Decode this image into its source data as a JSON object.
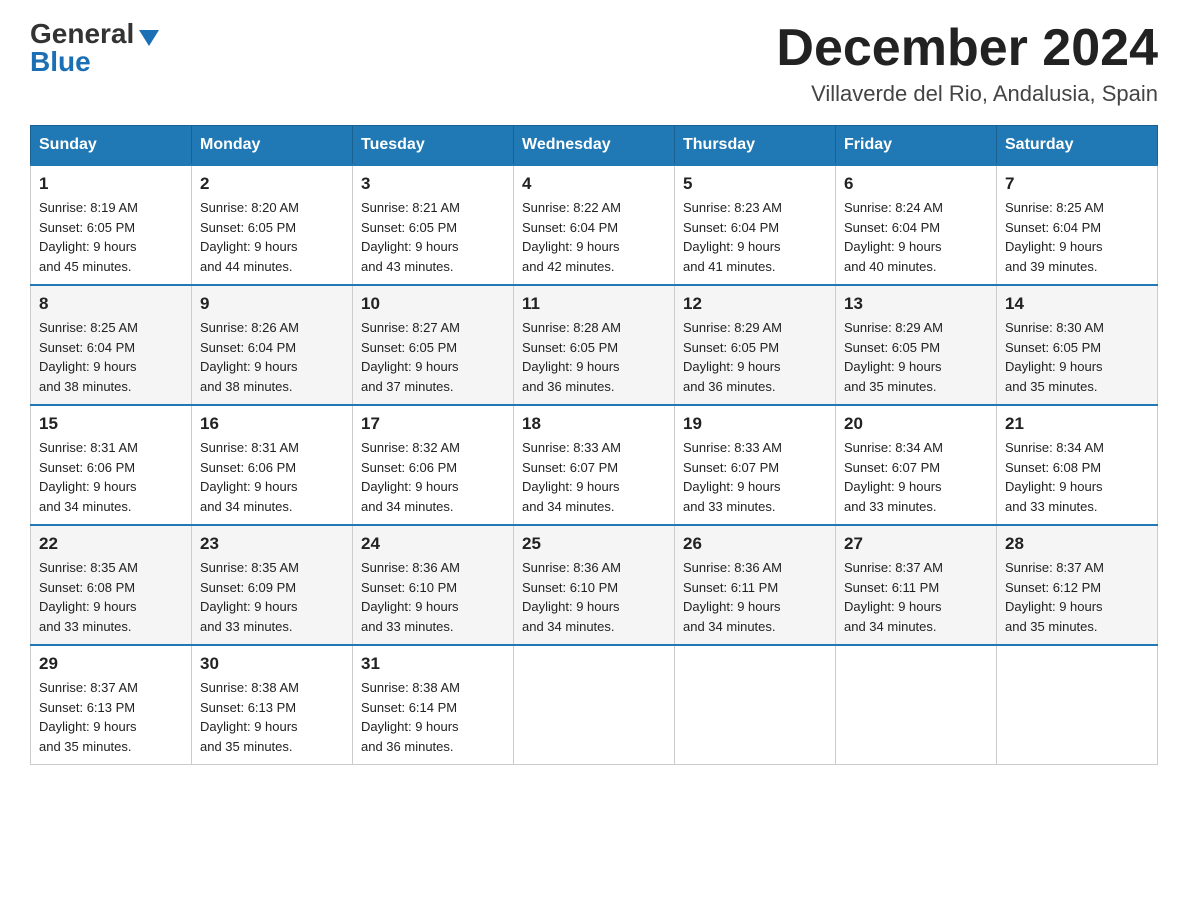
{
  "header": {
    "logo_general": "General",
    "logo_blue": "Blue",
    "month_title": "December 2024",
    "location": "Villaverde del Rio, Andalusia, Spain"
  },
  "days_of_week": [
    "Sunday",
    "Monday",
    "Tuesday",
    "Wednesday",
    "Thursday",
    "Friday",
    "Saturday"
  ],
  "weeks": [
    [
      {
        "day": "1",
        "sunrise": "Sunrise: 8:19 AM",
        "sunset": "Sunset: 6:05 PM",
        "daylight": "Daylight: 9 hours",
        "daylight2": "and 45 minutes."
      },
      {
        "day": "2",
        "sunrise": "Sunrise: 8:20 AM",
        "sunset": "Sunset: 6:05 PM",
        "daylight": "Daylight: 9 hours",
        "daylight2": "and 44 minutes."
      },
      {
        "day": "3",
        "sunrise": "Sunrise: 8:21 AM",
        "sunset": "Sunset: 6:05 PM",
        "daylight": "Daylight: 9 hours",
        "daylight2": "and 43 minutes."
      },
      {
        "day": "4",
        "sunrise": "Sunrise: 8:22 AM",
        "sunset": "Sunset: 6:04 PM",
        "daylight": "Daylight: 9 hours",
        "daylight2": "and 42 minutes."
      },
      {
        "day": "5",
        "sunrise": "Sunrise: 8:23 AM",
        "sunset": "Sunset: 6:04 PM",
        "daylight": "Daylight: 9 hours",
        "daylight2": "and 41 minutes."
      },
      {
        "day": "6",
        "sunrise": "Sunrise: 8:24 AM",
        "sunset": "Sunset: 6:04 PM",
        "daylight": "Daylight: 9 hours",
        "daylight2": "and 40 minutes."
      },
      {
        "day": "7",
        "sunrise": "Sunrise: 8:25 AM",
        "sunset": "Sunset: 6:04 PM",
        "daylight": "Daylight: 9 hours",
        "daylight2": "and 39 minutes."
      }
    ],
    [
      {
        "day": "8",
        "sunrise": "Sunrise: 8:25 AM",
        "sunset": "Sunset: 6:04 PM",
        "daylight": "Daylight: 9 hours",
        "daylight2": "and 38 minutes."
      },
      {
        "day": "9",
        "sunrise": "Sunrise: 8:26 AM",
        "sunset": "Sunset: 6:04 PM",
        "daylight": "Daylight: 9 hours",
        "daylight2": "and 38 minutes."
      },
      {
        "day": "10",
        "sunrise": "Sunrise: 8:27 AM",
        "sunset": "Sunset: 6:05 PM",
        "daylight": "Daylight: 9 hours",
        "daylight2": "and 37 minutes."
      },
      {
        "day": "11",
        "sunrise": "Sunrise: 8:28 AM",
        "sunset": "Sunset: 6:05 PM",
        "daylight": "Daylight: 9 hours",
        "daylight2": "and 36 minutes."
      },
      {
        "day": "12",
        "sunrise": "Sunrise: 8:29 AM",
        "sunset": "Sunset: 6:05 PM",
        "daylight": "Daylight: 9 hours",
        "daylight2": "and 36 minutes."
      },
      {
        "day": "13",
        "sunrise": "Sunrise: 8:29 AM",
        "sunset": "Sunset: 6:05 PM",
        "daylight": "Daylight: 9 hours",
        "daylight2": "and 35 minutes."
      },
      {
        "day": "14",
        "sunrise": "Sunrise: 8:30 AM",
        "sunset": "Sunset: 6:05 PM",
        "daylight": "Daylight: 9 hours",
        "daylight2": "and 35 minutes."
      }
    ],
    [
      {
        "day": "15",
        "sunrise": "Sunrise: 8:31 AM",
        "sunset": "Sunset: 6:06 PM",
        "daylight": "Daylight: 9 hours",
        "daylight2": "and 34 minutes."
      },
      {
        "day": "16",
        "sunrise": "Sunrise: 8:31 AM",
        "sunset": "Sunset: 6:06 PM",
        "daylight": "Daylight: 9 hours",
        "daylight2": "and 34 minutes."
      },
      {
        "day": "17",
        "sunrise": "Sunrise: 8:32 AM",
        "sunset": "Sunset: 6:06 PM",
        "daylight": "Daylight: 9 hours",
        "daylight2": "and 34 minutes."
      },
      {
        "day": "18",
        "sunrise": "Sunrise: 8:33 AM",
        "sunset": "Sunset: 6:07 PM",
        "daylight": "Daylight: 9 hours",
        "daylight2": "and 34 minutes."
      },
      {
        "day": "19",
        "sunrise": "Sunrise: 8:33 AM",
        "sunset": "Sunset: 6:07 PM",
        "daylight": "Daylight: 9 hours",
        "daylight2": "and 33 minutes."
      },
      {
        "day": "20",
        "sunrise": "Sunrise: 8:34 AM",
        "sunset": "Sunset: 6:07 PM",
        "daylight": "Daylight: 9 hours",
        "daylight2": "and 33 minutes."
      },
      {
        "day": "21",
        "sunrise": "Sunrise: 8:34 AM",
        "sunset": "Sunset: 6:08 PM",
        "daylight": "Daylight: 9 hours",
        "daylight2": "and 33 minutes."
      }
    ],
    [
      {
        "day": "22",
        "sunrise": "Sunrise: 8:35 AM",
        "sunset": "Sunset: 6:08 PM",
        "daylight": "Daylight: 9 hours",
        "daylight2": "and 33 minutes."
      },
      {
        "day": "23",
        "sunrise": "Sunrise: 8:35 AM",
        "sunset": "Sunset: 6:09 PM",
        "daylight": "Daylight: 9 hours",
        "daylight2": "and 33 minutes."
      },
      {
        "day": "24",
        "sunrise": "Sunrise: 8:36 AM",
        "sunset": "Sunset: 6:10 PM",
        "daylight": "Daylight: 9 hours",
        "daylight2": "and 33 minutes."
      },
      {
        "day": "25",
        "sunrise": "Sunrise: 8:36 AM",
        "sunset": "Sunset: 6:10 PM",
        "daylight": "Daylight: 9 hours",
        "daylight2": "and 34 minutes."
      },
      {
        "day": "26",
        "sunrise": "Sunrise: 8:36 AM",
        "sunset": "Sunset: 6:11 PM",
        "daylight": "Daylight: 9 hours",
        "daylight2": "and 34 minutes."
      },
      {
        "day": "27",
        "sunrise": "Sunrise: 8:37 AM",
        "sunset": "Sunset: 6:11 PM",
        "daylight": "Daylight: 9 hours",
        "daylight2": "and 34 minutes."
      },
      {
        "day": "28",
        "sunrise": "Sunrise: 8:37 AM",
        "sunset": "Sunset: 6:12 PM",
        "daylight": "Daylight: 9 hours",
        "daylight2": "and 35 minutes."
      }
    ],
    [
      {
        "day": "29",
        "sunrise": "Sunrise: 8:37 AM",
        "sunset": "Sunset: 6:13 PM",
        "daylight": "Daylight: 9 hours",
        "daylight2": "and 35 minutes."
      },
      {
        "day": "30",
        "sunrise": "Sunrise: 8:38 AM",
        "sunset": "Sunset: 6:13 PM",
        "daylight": "Daylight: 9 hours",
        "daylight2": "and 35 minutes."
      },
      {
        "day": "31",
        "sunrise": "Sunrise: 8:38 AM",
        "sunset": "Sunset: 6:14 PM",
        "daylight": "Daylight: 9 hours",
        "daylight2": "and 36 minutes."
      },
      null,
      null,
      null,
      null
    ]
  ]
}
